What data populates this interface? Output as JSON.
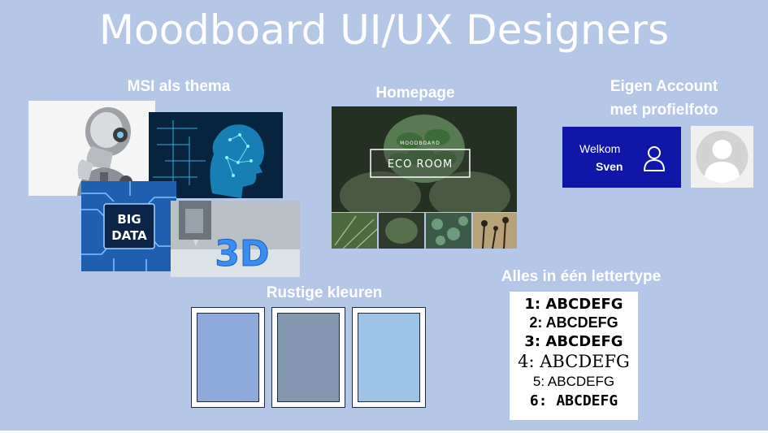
{
  "title": "Moodboard UI/UX Designers",
  "sections": {
    "theme": "MSI als thema",
    "homepage": "Homepage",
    "account_line1": "Eigen Account",
    "account_line2": "met profielfoto",
    "colors": "Rustige kleuren",
    "font": "Alles in één lettertype"
  },
  "theme_images": {
    "big_data_line1": "BIG",
    "big_data_line2": "DATA",
    "printer_text": "3D"
  },
  "homepage_image": {
    "brand": "MOODBOARD",
    "name": "ECO ROOM"
  },
  "account": {
    "greeting": "Welkom",
    "user": "Sven",
    "icon": "user-icon",
    "avatar": "default-avatar"
  },
  "swatches": [
    "#8ea9db",
    "#8497b0",
    "#9dc3e6"
  ],
  "font_samples": [
    "1: ABCDEFG",
    "2: ABCDEFG",
    "3: ABCDEFG",
    "4: ABCDEFG",
    "5: ABCDEFG",
    "6: ABCDEFG"
  ]
}
